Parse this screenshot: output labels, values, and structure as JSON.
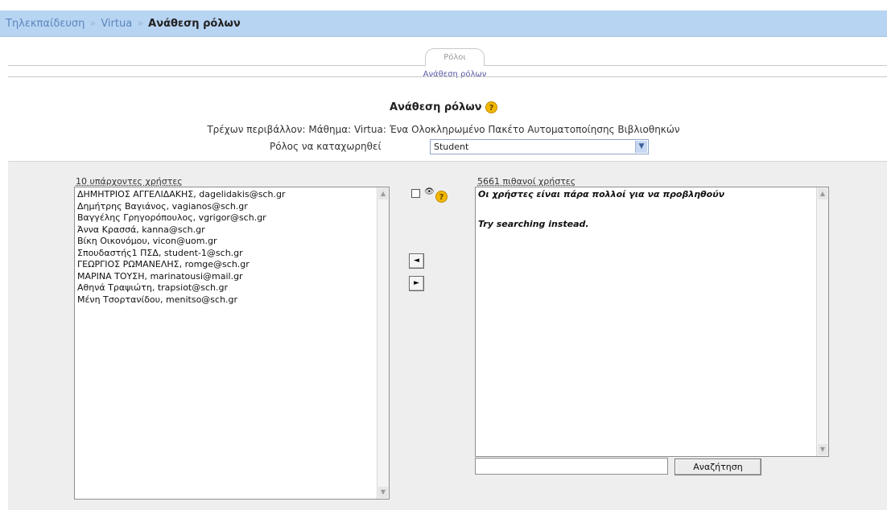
{
  "breadcrumb": {
    "items": [
      "Τηλεκπαίδευση",
      "Virtua"
    ],
    "separator": "»",
    "current": "Ανάθεση ρόλων"
  },
  "tabs": {
    "primary": "Ρόλοι",
    "secondary": "Ανάθεση ρόλων"
  },
  "page": {
    "title": "Ανάθεση ρόλων",
    "help_glyph": "?",
    "context_label": "Τρέχων περιβάλλον:",
    "context_value": "Μάθημα: Virtua: Ένα Ολοκληρωμένο Πακέτο Αυτοματοποίησης Βιβλιοθηκών",
    "role_label": "Ρόλος να καταχωρηθεί",
    "role_selected": "Student"
  },
  "existing": {
    "label": "10 υπάρχοντες χρήστες",
    "users": [
      "ΔΗΜΗΤΡΙΟΣ ΑΓΓΕΛΙΔΑΚΗΣ, dagelidakis@sch.gr",
      "Δημήτρης Βαγιάνος, vagianos@sch.gr",
      "Βαγγέλης Γρηγορόπουλος, vgrigor@sch.gr",
      "Άννα Κρασσά, kanna@sch.gr",
      "Βίκη Οικονόμου, vicon@uom.gr",
      "Σπουδαστής1 ΠΣΔ, student-1@sch.gr",
      "ΓΕΩΡΓΙΟΣ ΡΩΜΑΝΕΛΗΣ, romge@sch.gr",
      "ΜΑΡΙΝΑ ΤΟΥΣΗ, marinatousi@mail.gr",
      "Αθηνά Τραψιώτη, trapsiot@sch.gr",
      "Μένη Τσορτανίδου, menitso@sch.gr"
    ]
  },
  "potential": {
    "label": "5661 πιθανοί χρήστες",
    "message": "Οι χρήστες είναι πάρα πολλοί για να προβληθούν",
    "hint": "Try searching instead."
  },
  "controls": {
    "eye_glyph": "👁",
    "add_glyph": "◄",
    "remove_glyph": "►",
    "search_button": "Αναζήτηση",
    "search_value": ""
  }
}
